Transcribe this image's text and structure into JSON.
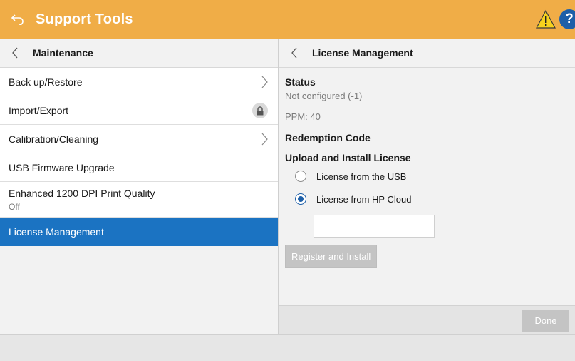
{
  "header": {
    "title": "Support Tools",
    "back_icon": "back-return-icon",
    "warning_icon": "warning-icon",
    "help_label": "?",
    "accent": "#f0ad47"
  },
  "left_pane": {
    "title": "Maintenance",
    "items": [
      {
        "label": "Back up/Restore",
        "icon": "chevron-right-icon"
      },
      {
        "label": "Import/Export",
        "icon": "lock-icon"
      },
      {
        "label": "Calibration/Cleaning",
        "icon": "chevron-right-icon"
      },
      {
        "label": "USB Firmware Upgrade"
      },
      {
        "label": "Enhanced 1200 DPI Print Quality",
        "value": "Off"
      },
      {
        "label": "License Management",
        "selected": true
      }
    ],
    "selected_color": "#1b73c2"
  },
  "right_pane": {
    "title": "License Management",
    "status_title": "Status",
    "status_value": "Not configured (-1)",
    "ppm": "PPM: 40",
    "redemption_title": "Redemption Code",
    "upload_title": "Upload and Install License",
    "options": [
      {
        "label": "License from the USB",
        "checked": false
      },
      {
        "label": "License from HP Cloud",
        "checked": true
      }
    ],
    "input_value": "",
    "register_button": "Register and Install",
    "done_button": "Done"
  }
}
